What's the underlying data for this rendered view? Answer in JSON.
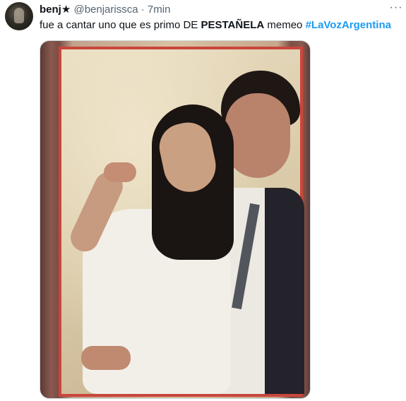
{
  "tweet": {
    "author": {
      "name": "benj★",
      "handle": "@benjarissca",
      "separator": "·",
      "time": "7min"
    },
    "more_label": "···",
    "text": {
      "part1": "fue a cantar uno que es primo DE ",
      "bold": "PESTAÑELA",
      "part2": " memeo ",
      "hashtag": "#LaVozArgentina"
    },
    "media": {
      "kind": "photo"
    }
  },
  "colors": {
    "text": "#0f1419",
    "secondary": "#536471",
    "link": "#1d9bf0",
    "frame_border": "#c9463c"
  }
}
